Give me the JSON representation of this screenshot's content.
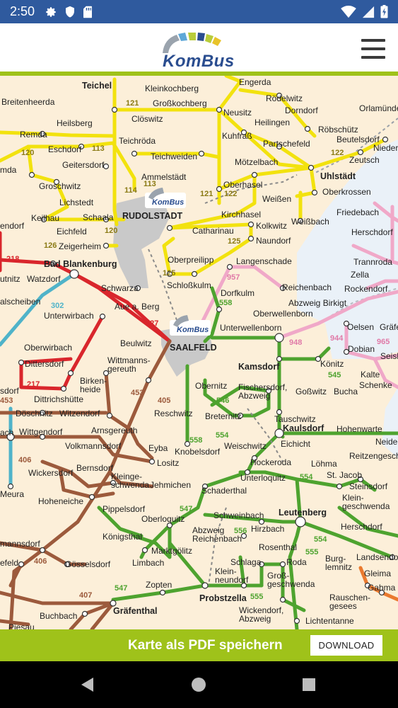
{
  "status_bar": {
    "time": "2:50",
    "left_icons": [
      "gear-icon",
      "shield-icon",
      "sd-card-icon"
    ],
    "right_icons": [
      "wifi-icon",
      "signal-icon",
      "battery-icon"
    ]
  },
  "header": {
    "logo_text": "KomBus",
    "menu_icon": "hamburger-menu-icon"
  },
  "map": {
    "places": [
      {
        "id": "teichel",
        "name": "Teichel",
        "bold": true
      },
      {
        "id": "engerda",
        "name": "Engerda"
      },
      {
        "id": "roedelwitz",
        "name": "Rödelwitz"
      },
      {
        "id": "orlamuende",
        "name": "Orlamünde"
      },
      {
        "id": "breitenheerda",
        "name": "Breitenheerda"
      },
      {
        "id": "kleinkochberg",
        "name": "Kleinkochberg"
      },
      {
        "id": "grosskochberg",
        "name": "Großkochberg"
      },
      {
        "id": "neusitz",
        "name": "Neusitz"
      },
      {
        "id": "dorndorf",
        "name": "Dorndorf"
      },
      {
        "id": "heilsberg",
        "name": "Heilsberg"
      },
      {
        "id": "cloeswitz",
        "name": "Clöswitz"
      },
      {
        "id": "heilingen",
        "name": "Heilingen"
      },
      {
        "id": "roebschuetz",
        "name": "Röbschütz"
      },
      {
        "id": "remda",
        "name": "Remda"
      },
      {
        "id": "teichroeda",
        "name": "Teichröda"
      },
      {
        "id": "kuhfrass",
        "name": "Kuhfraß"
      },
      {
        "id": "beutelsdorf",
        "name": "Beutelsdorf"
      },
      {
        "id": "eschdorf",
        "name": "Eschdorf"
      },
      {
        "id": "partschefeld",
        "name": "Partschefeld"
      },
      {
        "id": "nieder",
        "name": "Nieder"
      },
      {
        "id": "teichweiden",
        "name": "Teichweiden"
      },
      {
        "id": "zeutsch",
        "name": "Zeutsch"
      },
      {
        "id": "geitersdorf",
        "name": "Geitersdorf"
      },
      {
        "id": "moetzelbach",
        "name": "Mötzelbach"
      },
      {
        "id": "mda",
        "name": "mda"
      },
      {
        "id": "ammelstaedt",
        "name": "Ammelstädt"
      },
      {
        "id": "uhlstaedt",
        "name": "Uhlstädt",
        "bold": true
      },
      {
        "id": "groschwitz",
        "name": "Groschwitz"
      },
      {
        "id": "oberhasel",
        "name": "Oberhasel"
      },
      {
        "id": "oberkrossen",
        "name": "Oberkrossen"
      },
      {
        "id": "lichstedt",
        "name": "Lichstedt"
      },
      {
        "id": "weissen",
        "name": "Weißen"
      },
      {
        "id": "friedebach",
        "name": "Friedebach"
      },
      {
        "id": "keilhau",
        "name": "Keilhau"
      },
      {
        "id": "schaala",
        "name": "Schaala"
      },
      {
        "id": "rudolstadt",
        "name": "RUDOLSTADT",
        "bold": true
      },
      {
        "id": "kirchhasel",
        "name": "Kirchhasel"
      },
      {
        "id": "weissbach",
        "name": "Weißbach"
      },
      {
        "id": "endorf",
        "name": "endorf"
      },
      {
        "id": "eichfeld",
        "name": "Eichfeld"
      },
      {
        "id": "catharinau",
        "name": "Catharinau"
      },
      {
        "id": "kolkwitz",
        "name": "Kolkwitz"
      },
      {
        "id": "herschdorf_n",
        "name": "Herschdorf"
      },
      {
        "id": "zeigerheim",
        "name": "Zeigerheim"
      },
      {
        "id": "naundorf",
        "name": "Naundorf"
      },
      {
        "id": "oberpreilipp",
        "name": "Oberpreilipp"
      },
      {
        "id": "langenschade",
        "name": "Langenschade"
      },
      {
        "id": "trannroda",
        "name": "Trannroda"
      },
      {
        "id": "bad_blankenburg",
        "name": "Bad Blankenburg",
        "bold": true
      },
      {
        "id": "zella",
        "name": "Zella"
      },
      {
        "id": "utnitz",
        "name": "utnitz"
      },
      {
        "id": "watzdorf",
        "name": "Watzdorf"
      },
      {
        "id": "schlosskulm",
        "name": "Schloßkulm"
      },
      {
        "id": "reichenbach_n",
        "name": "Reichenbach"
      },
      {
        "id": "rockendorf",
        "name": "Rockendorf"
      },
      {
        "id": "schwarza",
        "name": "Schwarza"
      },
      {
        "id": "dorfkulm",
        "name": "Dorfkulm"
      },
      {
        "id": "abzweig_birkigt",
        "name": "Abzweig Birkigt"
      },
      {
        "id": "alscheiben",
        "name": "alscheiben"
      },
      {
        "id": "aue_a_berg",
        "name": "Aue a. Berg"
      },
      {
        "id": "oberwellenborn",
        "name": "Oberwellenborn"
      },
      {
        "id": "unterwirbach",
        "name": "Unterwirbach"
      },
      {
        "id": "unterwellenborn",
        "name": "Unterwellenborn"
      },
      {
        "id": "oelsen",
        "name": "Oelsen"
      },
      {
        "id": "graef",
        "name": "Gräfe"
      },
      {
        "id": "beulwitz",
        "name": "Beulwitz"
      },
      {
        "id": "saalfeld",
        "name": "SAALFELD",
        "bold": true
      },
      {
        "id": "oberwirbach",
        "name": "Oberwirbach"
      },
      {
        "id": "dobian",
        "name": "Dobian"
      },
      {
        "id": "seisl",
        "name": "Seisl"
      },
      {
        "id": "kamsdorf",
        "name": "Kamsdorf",
        "bold": true
      },
      {
        "id": "koenitz",
        "name": "Könitz"
      },
      {
        "id": "dittersdorf",
        "name": "Dittersdorf"
      },
      {
        "id": "wittmannsgereuth",
        "name": "Wittmanns-\ngereuth"
      },
      {
        "id": "kalte",
        "name": "Kalte"
      },
      {
        "id": "birkenheide",
        "name": "Birken-\nheide"
      },
      {
        "id": "obernitz",
        "name": "Obernitz"
      },
      {
        "id": "fischersdorf",
        "name": "Fischersdorf,\nAbzweig"
      },
      {
        "id": "gosswitz",
        "name": "Goßwitz"
      },
      {
        "id": "bucha",
        "name": "Bucha"
      },
      {
        "id": "schenke",
        "name": "Schenke"
      },
      {
        "id": "sdorf",
        "name": "sdorf"
      },
      {
        "id": "dittrichshuette",
        "name": "Dittrichshütte"
      },
      {
        "id": "doeschnitz",
        "name": "Döschnitz"
      },
      {
        "id": "witzendorf",
        "name": "Witzendorf"
      },
      {
        "id": "reschwitz",
        "name": "Reschwitz"
      },
      {
        "id": "breternitz",
        "name": "Breternitz"
      },
      {
        "id": "tauschwitz",
        "name": "Tauschwitz"
      },
      {
        "id": "ach",
        "name": "ach"
      },
      {
        "id": "wittgendorf",
        "name": "Wittgendorf"
      },
      {
        "id": "arnsgereuth",
        "name": "Arnsgereuth"
      },
      {
        "id": "kaulsdorf",
        "name": "Kaulsdorf",
        "bold": true
      },
      {
        "id": "hohenwarte",
        "name": "Hohenwarte"
      },
      {
        "id": "volkmannsdorf",
        "name": "Volkmannsdorf"
      },
      {
        "id": "eyba",
        "name": "Eyba"
      },
      {
        "id": "knobelsdorf",
        "name": "Knobelsdorf"
      },
      {
        "id": "weischwitz",
        "name": "Weischwitz"
      },
      {
        "id": "eichicht",
        "name": "Eichicht"
      },
      {
        "id": "neide",
        "name": "Neide"
      },
      {
        "id": "reitzengesch",
        "name": "Reitzengesch"
      },
      {
        "id": "lositz",
        "name": "Lositz"
      },
      {
        "id": "hockeroda",
        "name": "Hockeroda"
      },
      {
        "id": "loehma",
        "name": "Löhma"
      },
      {
        "id": "bernsdorf",
        "name": "Bernsdorf"
      },
      {
        "id": "wickersdorf",
        "name": "Wickersdorf"
      },
      {
        "id": "st_jacob",
        "name": "St. Jacob"
      },
      {
        "id": "kleingeschwenda",
        "name": "Kleinge-\nschwenda"
      },
      {
        "id": "unterloquitz",
        "name": "Unterloquitz"
      },
      {
        "id": "meura",
        "name": "Meura"
      },
      {
        "id": "jehmichen",
        "name": "Jehmichen"
      },
      {
        "id": "steinsdorf",
        "name": "Steinsdorf"
      },
      {
        "id": "hoheneiche",
        "name": "Hoheneiche"
      },
      {
        "id": "schaderthal",
        "name": "Schaderthal"
      },
      {
        "id": "kleingeschwenda2",
        "name": "Klein-\ngeschwenda"
      },
      {
        "id": "pippelsdorf",
        "name": "Pippelsdorf"
      },
      {
        "id": "schweinbach",
        "name": "Schweinbach"
      },
      {
        "id": "leutenberg",
        "name": "Leutenberg",
        "bold": true
      },
      {
        "id": "oberloquitz",
        "name": "Oberloquitz"
      },
      {
        "id": "herschdorf_s",
        "name": "Herschdorf"
      },
      {
        "id": "koenigsthal",
        "name": "Königsthal"
      },
      {
        "id": "abzweig_reichenbach",
        "name": "Abzweig\nReichenbach"
      },
      {
        "id": "hirzbach",
        "name": "Hirzbach"
      },
      {
        "id": "mannsdorf",
        "name": "mannsdorf"
      },
      {
        "id": "marktgoelitz",
        "name": "Marktgölitz"
      },
      {
        "id": "rosenthal",
        "name": "Rosenthal"
      },
      {
        "id": "landsendorf",
        "name": "Landsendorf"
      },
      {
        "id": "efeld",
        "name": "efeld"
      },
      {
        "id": "goesselsdorf",
        "name": "Gösselsdorf"
      },
      {
        "id": "limbach",
        "name": "Limbach"
      },
      {
        "id": "schlaga",
        "name": "Schlaga"
      },
      {
        "id": "roda",
        "name": "Roda"
      },
      {
        "id": "burglemnitz",
        "name": "Burg-\nlemnitz"
      },
      {
        "id": "gleima",
        "name": "Gleima"
      },
      {
        "id": "kleinneundorf",
        "name": "Klein-\nneundorf"
      },
      {
        "id": "grossgeschwenda",
        "name": "Groß-\ngeschwenda"
      },
      {
        "id": "gahma",
        "name": "Gahma"
      },
      {
        "id": "zopten",
        "name": "Zopten"
      },
      {
        "id": "rauschengesees",
        "name": "Rauschen-\ngesees"
      },
      {
        "id": "graefenthal",
        "name": "Gräfenthal",
        "bold": true
      },
      {
        "id": "probstzella",
        "name": "Probstzella",
        "bold": true
      },
      {
        "id": "wickendorf",
        "name": "Wickendorf,\nAbzweig"
      },
      {
        "id": "buchbach",
        "name": "Buchbach"
      },
      {
        "id": "lichtentanne",
        "name": "Lichtentanne"
      },
      {
        "id": "piesau",
        "name": "Piesau"
      }
    ],
    "line_numbers": [
      {
        "id": "n121a",
        "text": "121",
        "color": "#8a7a14"
      },
      {
        "id": "n121b",
        "text": "121",
        "color": "#8a7a14"
      },
      {
        "id": "n122a",
        "text": "122",
        "color": "#8a7a14"
      },
      {
        "id": "n122b",
        "text": "122",
        "color": "#8a7a14"
      },
      {
        "id": "n120a",
        "text": "120",
        "color": "#8a7a14"
      },
      {
        "id": "n120b",
        "text": "120",
        "color": "#8a7a14"
      },
      {
        "id": "n113a",
        "text": "113",
        "color": "#8a7a14"
      },
      {
        "id": "n113b",
        "text": "113",
        "color": "#8a7a14"
      },
      {
        "id": "n114",
        "text": "114",
        "color": "#8a7a14"
      },
      {
        "id": "n126",
        "text": "126",
        "color": "#8a7a14"
      },
      {
        "id": "n125a",
        "text": "125",
        "color": "#8a7a14"
      },
      {
        "id": "n125b",
        "text": "125",
        "color": "#8a7a14"
      },
      {
        "id": "n218",
        "text": "218",
        "color": "#d9262c"
      },
      {
        "id": "n227",
        "text": "227",
        "color": "#d9262c"
      },
      {
        "id": "n217",
        "text": "217",
        "color": "#d9262c"
      },
      {
        "id": "n302",
        "text": "302",
        "color": "#4fb3c9"
      },
      {
        "id": "n957",
        "text": "957",
        "color": "#e07aa8"
      },
      {
        "id": "n558a",
        "text": "558",
        "color": "#4ea32f"
      },
      {
        "id": "n558b",
        "text": "558",
        "color": "#4ea32f"
      },
      {
        "id": "n948",
        "text": "948",
        "color": "#e07aa8"
      },
      {
        "id": "n944",
        "text": "944",
        "color": "#e07aa8"
      },
      {
        "id": "n965",
        "text": "965",
        "color": "#e07aa8"
      },
      {
        "id": "n545",
        "text": "545",
        "color": "#4ea32f"
      },
      {
        "id": "n546",
        "text": "546",
        "color": "#4ea32f"
      },
      {
        "id": "n554a",
        "text": "554",
        "color": "#4ea32f"
      },
      {
        "id": "n554b",
        "text": "554",
        "color": "#4ea32f"
      },
      {
        "id": "n554c",
        "text": "554",
        "color": "#4ea32f"
      },
      {
        "id": "n453a",
        "text": "453",
        "color": "#9c5a3c"
      },
      {
        "id": "n453b",
        "text": "453",
        "color": "#9c5a3c"
      },
      {
        "id": "n405",
        "text": "405",
        "color": "#9c5a3c"
      },
      {
        "id": "n406a",
        "text": "406",
        "color": "#9c5a3c"
      },
      {
        "id": "n406b",
        "text": "406",
        "color": "#9c5a3c"
      },
      {
        "id": "n407",
        "text": "407",
        "color": "#9c5a3c"
      },
      {
        "id": "n547a",
        "text": "547",
        "color": "#4ea32f"
      },
      {
        "id": "n547b",
        "text": "547",
        "color": "#4ea32f"
      },
      {
        "id": "n556",
        "text": "556",
        "color": "#4ea32f"
      },
      {
        "id": "n555a",
        "text": "555",
        "color": "#4ea32f"
      },
      {
        "id": "n555b",
        "text": "555",
        "color": "#4ea32f"
      }
    ],
    "city_badges": [
      "KomBus",
      "KomBus"
    ]
  },
  "bottom_bar": {
    "label": "Karte als PDF speichern",
    "button": "DOWNLOAD"
  },
  "nav_bar": {
    "back": "back-icon",
    "home": "home-icon",
    "recents": "recents-icon"
  },
  "colors": {
    "status_bar": "#2f5a9e",
    "accent_green": "#9fc21a",
    "map_bg": "#fcefd9",
    "line_yellow": "#f2e20e",
    "line_red": "#d9262c",
    "line_brown": "#9c5a3c",
    "line_green": "#4ea32f",
    "line_pink": "#f0a8c8",
    "line_cyan": "#4fb3c9",
    "line_orange": "#ea7a2f"
  }
}
